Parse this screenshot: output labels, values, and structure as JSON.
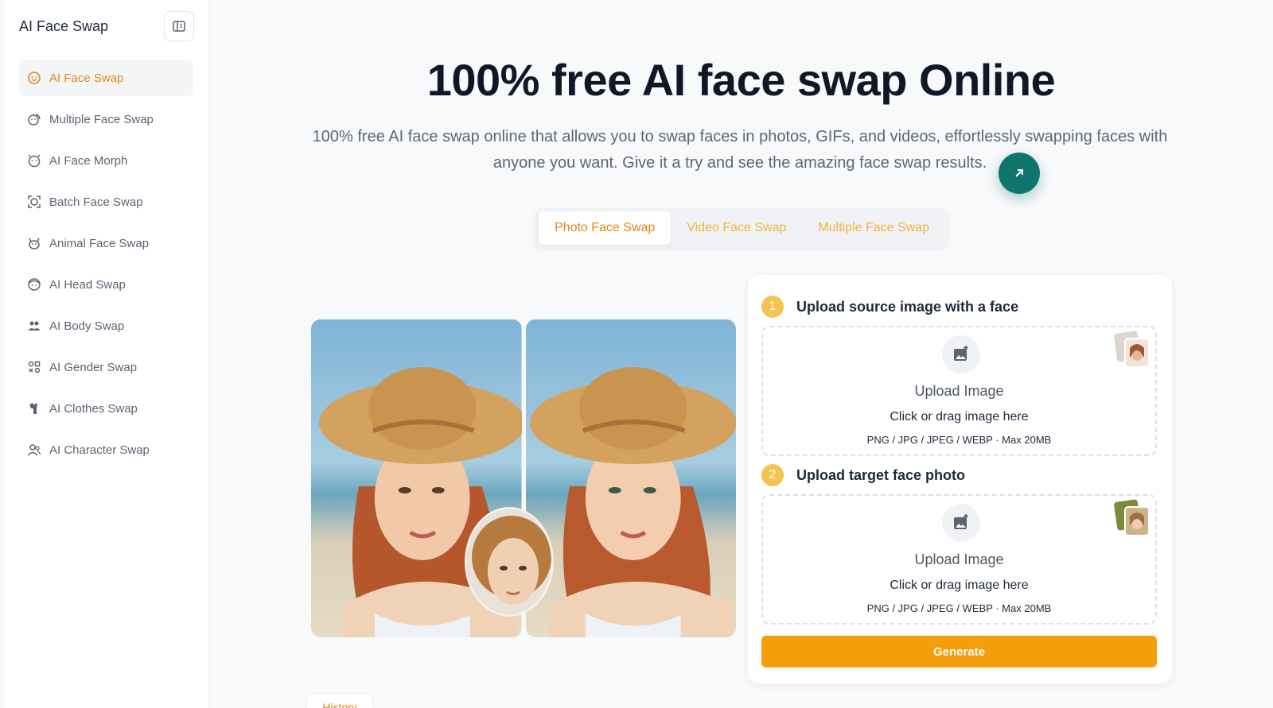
{
  "sidebar": {
    "brand": "AI Face Swap",
    "items": [
      {
        "label": "AI Face Swap",
        "icon": "face-smile-icon",
        "active": true
      },
      {
        "label": "Multiple Face Swap",
        "icon": "multi-face-icon"
      },
      {
        "label": "AI Face Morph",
        "icon": "face-morph-icon"
      },
      {
        "label": "Batch Face Swap",
        "icon": "batch-face-icon"
      },
      {
        "label": "Animal Face Swap",
        "icon": "cat-icon"
      },
      {
        "label": "AI Head Swap",
        "icon": "head-icon"
      },
      {
        "label": "AI Body Swap",
        "icon": "body-icon"
      },
      {
        "label": "AI Gender Swap",
        "icon": "gender-icon"
      },
      {
        "label": "AI Clothes Swap",
        "icon": "clothes-icon"
      },
      {
        "label": "AI Character Swap",
        "icon": "character-icon"
      }
    ]
  },
  "hero": {
    "title": "100% free AI face swap Online",
    "subtitle": "100% free AI face swap online that allows you to swap faces in photos, GIFs, and videos, effortlessly swapping faces with anyone you want. Give it a try and see the amazing face swap results."
  },
  "tabs": [
    {
      "label": "Photo Face Swap",
      "active": true
    },
    {
      "label": "Video Face Swap"
    },
    {
      "label": "Multiple Face Swap"
    }
  ],
  "upload": {
    "step1": {
      "num": "1",
      "title": "Upload source image with a face"
    },
    "step2": {
      "num": "2",
      "title": "Upload target face photo"
    },
    "drop_title": "Upload Image",
    "drop_hint": "Click or drag image here",
    "drop_formats": "PNG / JPG / JPEG / WEBP · Max 20MB",
    "generate_label": "Generate"
  },
  "history_label": "History",
  "colors": {
    "accent": "#e0861a",
    "button": "#f59e0b",
    "fab": "#0f766e",
    "step": "#f3c44f"
  }
}
